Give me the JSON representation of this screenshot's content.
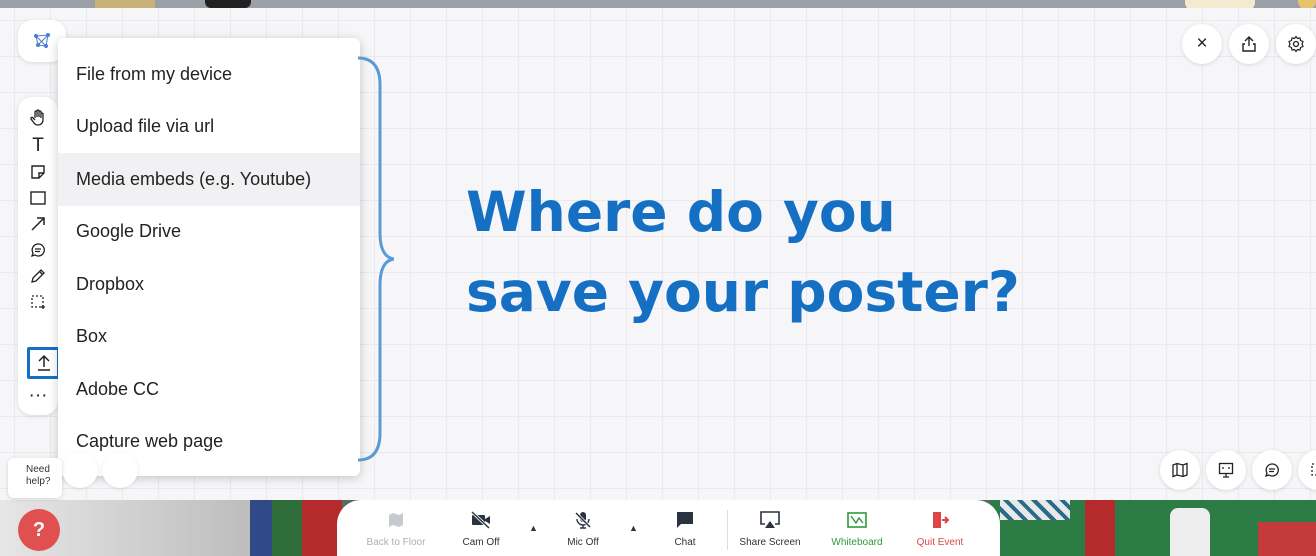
{
  "menu": {
    "items": [
      "File from my device",
      "Upload file via url",
      "Media embeds (e.g. Youtube)",
      "Google Drive",
      "Dropbox",
      "Box",
      "Adobe CC",
      "Capture web page"
    ]
  },
  "headline": {
    "line1": "Where do you",
    "line2": "save your poster?"
  },
  "help": {
    "text1": "Need",
    "text2": "help?"
  },
  "controls": {
    "back_to_floor": "Back to Floor",
    "cam_off": "Cam Off",
    "mic_off": "Mic Off",
    "chat": "Chat",
    "share_screen": "Share Screen",
    "whiteboard": "Whiteboard",
    "quit_event": "Quit Event"
  },
  "colors": {
    "accent_blue": "#1570c4",
    "whiteboard_green": "#2e9a3c",
    "quit_red": "#e04545",
    "help_red": "#e05050"
  },
  "icons": {
    "toolbar": [
      "hand-icon",
      "text-icon",
      "sticky-note-icon",
      "rectangle-icon",
      "arrow-icon",
      "comment-icon",
      "pencil-icon",
      "select-area-icon",
      "upload-icon",
      "more-icon"
    ],
    "top_right": [
      "close-icon",
      "share-icon",
      "settings-icon"
    ],
    "bottom_right": [
      "map-icon",
      "presentation-icon",
      "chat-icon",
      "select-icon"
    ]
  }
}
